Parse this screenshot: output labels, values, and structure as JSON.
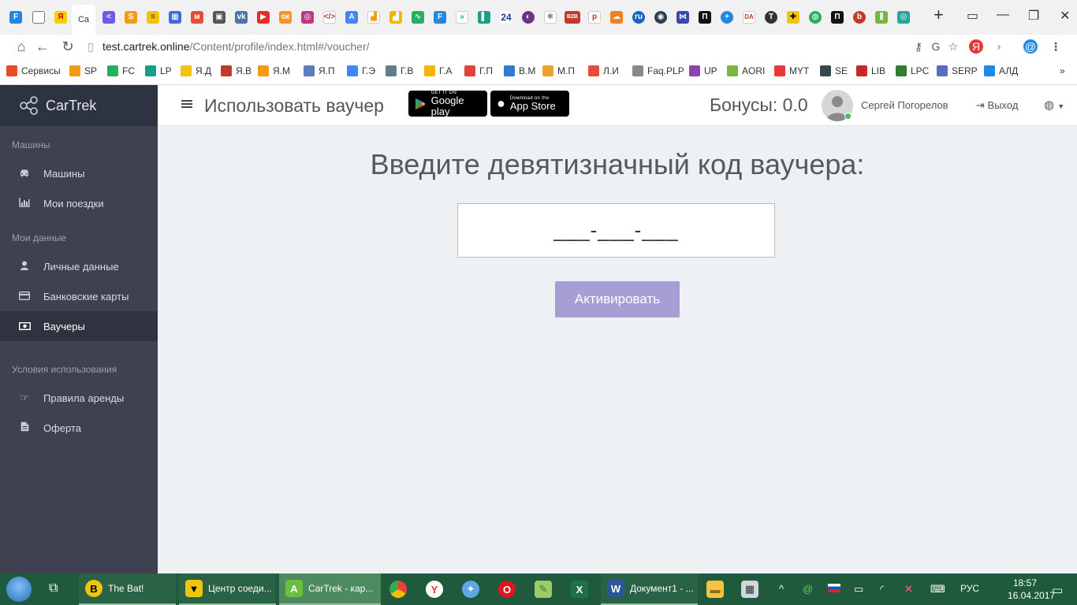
{
  "browser": {
    "url_host": "test.cartrek.online",
    "url_path": "/Content/profile/index.html#/voucher/",
    "active_tab_label": "Ca",
    "tab_badges": [
      "24",
      "B2B"
    ],
    "bookmarks": [
      {
        "label": "Сервисы",
        "icon": "apps-grid-icon",
        "color": "#e44d26"
      },
      {
        "label": "SP",
        "icon": "s-icon",
        "color": "#f39c12"
      },
      {
        "label": "FC",
        "icon": "chevrons-icon",
        "color": "#27ae60"
      },
      {
        "label": "LP",
        "icon": "bars-icon",
        "color": "#16a085"
      },
      {
        "label": "Я.Д",
        "icon": "yandex-direct-icon",
        "color": "#f1c40f"
      },
      {
        "label": "Я.В",
        "icon": "code-icon",
        "color": "#c0392b"
      },
      {
        "label": "Я.М",
        "icon": "chart-icon",
        "color": "#f39c12"
      },
      {
        "label": "Я.П",
        "icon": "mail-icon",
        "color": "#5b7db8"
      },
      {
        "label": "Г.Э",
        "icon": "adwords-icon",
        "color": "#4285f4"
      },
      {
        "label": "Г.В",
        "icon": "lock-icon",
        "color": "#607d8b"
      },
      {
        "label": "Г.А",
        "icon": "analytics-icon",
        "color": "#f4b400"
      },
      {
        "label": "Г.П",
        "icon": "gmail-icon",
        "color": "#db4437"
      },
      {
        "label": "В.М",
        "icon": "search-icon",
        "color": "#2e7bcf"
      },
      {
        "label": "М.П",
        "icon": "target-icon",
        "color": "#f0a030"
      },
      {
        "label": "Л.И",
        "icon": "trend-icon",
        "color": "#e74c3c"
      },
      {
        "label": "Faq.PLP",
        "icon": "page-icon",
        "color": "#888888"
      },
      {
        "label": "UP",
        "icon": "diamond-icon",
        "color": "#8e44ad"
      },
      {
        "label": "AORI",
        "icon": "a-icon",
        "color": "#7cb342"
      },
      {
        "label": "MYT",
        "icon": "ring-icon",
        "color": "#e53935"
      },
      {
        "label": "SE",
        "icon": "bars-icon",
        "color": "#37474f"
      },
      {
        "label": "LIB",
        "icon": "s-icon",
        "color": "#c62828"
      },
      {
        "label": "LPC",
        "icon": "triangle-icon",
        "color": "#2e7d32"
      },
      {
        "label": "SERP",
        "icon": "swirl-icon",
        "color": "#5c6bc0"
      },
      {
        "label": "АЛД",
        "icon": "car-icon",
        "color": "#1e88e5"
      }
    ]
  },
  "app": {
    "brand": "CarTrek",
    "page_title": "Использовать ваучер",
    "google_play_small": "GET IT ON",
    "google_play_big": "Google play",
    "app_store_small": "Download on the",
    "app_store_big": "App Store",
    "bonus": "Бонусы: 0.0",
    "username": "Сергей Погорелов",
    "logout": "Выход",
    "sidebar": {
      "sections": [
        {
          "title": "Машины",
          "items": [
            {
              "label": "Машины",
              "icon": "car-icon",
              "active": false
            },
            {
              "label": "Мои поездки",
              "icon": "bar-chart-icon",
              "active": false
            }
          ]
        },
        {
          "title": "Мои данные",
          "items": [
            {
              "label": "Личные данные",
              "icon": "user-icon",
              "active": false
            },
            {
              "label": "Банковские карты",
              "icon": "credit-card-icon",
              "active": false
            },
            {
              "label": "Ваучеры",
              "icon": "money-icon",
              "active": true
            }
          ]
        },
        {
          "title": "Условия использования",
          "items": [
            {
              "label": "Правила аренды",
              "icon": "hand-point-icon",
              "active": false
            },
            {
              "label": "Оферта",
              "icon": "file-icon",
              "active": false
            }
          ]
        }
      ]
    },
    "voucher": {
      "heading": "Введите девятизначный код ваучера:",
      "input_value": "___-___-___",
      "button": "Активировать"
    }
  },
  "taskbar": {
    "windows": [
      {
        "label": "The Bat!",
        "icon": "bat-icon",
        "active": false
      },
      {
        "label": "Центр соеди...",
        "icon": "batman-icon",
        "active": false
      },
      {
        "label": "CarTrek - кар...",
        "icon": "a-icon",
        "active": true
      },
      {
        "label": "Документ1 - ...",
        "icon": "word-icon",
        "active": false
      }
    ],
    "pinned": [
      "chrome-icon",
      "yandex-icon",
      "safari-icon",
      "opera-icon",
      "notepad-icon",
      "excel-icon",
      "folder-icon",
      "calculator-icon"
    ],
    "lang": "РУС",
    "time": "18:57",
    "date": "16.04.2017"
  },
  "colors": {
    "sidebar_bg": "#3d4150",
    "brand_bg": "#2e3342",
    "active_item_bg": "#2f3340",
    "button_bg": "#a79fd4",
    "content_bg": "#eef1f3",
    "taskbar_bg": "#1f5a3d"
  }
}
